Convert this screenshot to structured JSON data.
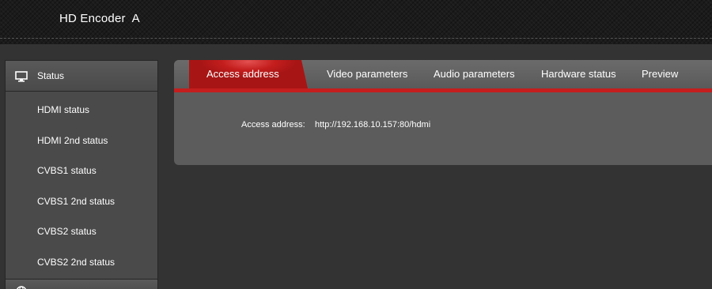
{
  "header": {
    "title": "HD Encoder  A"
  },
  "sidebar": {
    "section_label": "Status",
    "items": [
      {
        "label": "HDMI status"
      },
      {
        "label": "HDMI 2nd status"
      },
      {
        "label": "CVBS1 status"
      },
      {
        "label": "CVBS1 2nd status"
      },
      {
        "label": "CVBS2 status"
      },
      {
        "label": "CVBS2 2nd status"
      }
    ]
  },
  "tabs": [
    {
      "label": "Access address",
      "active": true
    },
    {
      "label": "Video parameters"
    },
    {
      "label": "Audio parameters"
    },
    {
      "label": "Hardware status"
    },
    {
      "label": "Preview"
    }
  ],
  "content": {
    "access_label": "Access address:",
    "access_value": "http://192.168.10.157:80/hdmi"
  },
  "colors": {
    "accent": "#c41e1e",
    "header_bg": "#1b1b1b",
    "sidebar_bg": "#4a4a4a",
    "panel_bg": "#5c5c5c",
    "page_bg": "#333333"
  }
}
